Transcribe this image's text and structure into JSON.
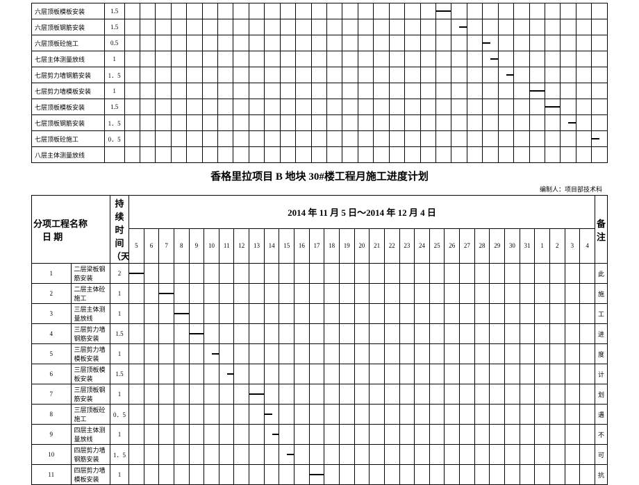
{
  "title": "香格里拉项目 B 地块 30#楼工程月施工进度计划",
  "author_label": "编制人：项目部技术科",
  "date_range": "2014 年 11 月 5 日～2014 年 12 月 4 日",
  "header_left": "分项工程名称\n　日 期",
  "header_dur": "持续时间（天）",
  "header_notes": "备注",
  "notes_chars": [
    "此",
    "施",
    "工",
    "进",
    "度",
    "计",
    "划",
    "遇",
    "不",
    "可",
    "抗"
  ],
  "bottom_days": [
    5,
    6,
    7,
    8,
    9,
    10,
    11,
    12,
    13,
    14,
    15,
    16,
    17,
    18,
    19,
    20,
    21,
    22,
    23,
    24,
    25,
    26,
    27,
    28,
    29,
    30,
    31,
    1,
    2,
    3,
    4
  ],
  "chart_data": [
    {
      "type": "table",
      "rows": [
        {
          "name": "六层顶板模板安装",
          "dur": "1.5",
          "start": 20,
          "len": 1.5
        },
        {
          "name": "六层顶板钢筋安装",
          "dur": "1.5",
          "start": 21.5,
          "len": 1.5
        },
        {
          "name": "六层顶板砼施工",
          "dur": "0.5",
          "start": 23,
          "len": 0.5
        },
        {
          "name": "七层主体测量放线",
          "dur": "1",
          "start": 23.5,
          "len": 1
        },
        {
          "name": "七层剪力墙钢筋安装",
          "dur": "1．5",
          "start": 24.5,
          "len": 1.5
        },
        {
          "name": "七层剪力墙模板安装",
          "dur": "1",
          "start": 26,
          "len": 1
        },
        {
          "name": "七层顶板模板安装",
          "dur": "1.5",
          "start": 27,
          "len": 1.5
        },
        {
          "name": "七层顶板钢筋安装",
          "dur": "1．5",
          "start": 28.5,
          "len": 1.5
        },
        {
          "name": "七层顶板砼施工",
          "dur": "0．5",
          "start": 30,
          "len": 0.5
        },
        {
          "name": "八层主体测量放线",
          "dur": "",
          "start": null,
          "len": null
        }
      ]
    },
    {
      "type": "table",
      "rows": [
        {
          "idx": 1,
          "name": "二层梁板钢筋安装",
          "dur": "2",
          "start": 0,
          "len": 2,
          "note": "此"
        },
        {
          "idx": 2,
          "name": "二层主体砼施工",
          "dur": "1",
          "start": 2,
          "len": 1,
          "note": "施"
        },
        {
          "idx": 3,
          "name": "三层主体测量放线",
          "dur": "1",
          "start": 3,
          "len": 1,
          "note": "工"
        },
        {
          "idx": 4,
          "name": "三层剪力墙钢筋安装",
          "dur": "1.5",
          "start": 4,
          "len": 1.5,
          "note": "进"
        },
        {
          "idx": 5,
          "name": "三层剪力墙模板安装",
          "dur": "1",
          "start": 5.5,
          "len": 1,
          "special": 1,
          "note": "度"
        },
        {
          "idx": 6,
          "name": "三层顶板模板安装",
          "dur": "1.5",
          "start": 6.5,
          "len": 1.5,
          "note": "计"
        },
        {
          "idx": 7,
          "name": "三层顶板钢筋安装",
          "dur": "1",
          "start": 8,
          "len": 1,
          "note": "划"
        },
        {
          "idx": 8,
          "name": "三层顶板砼施工",
          "dur": "0．5",
          "start": 9,
          "len": 0.5,
          "note": "遇"
        },
        {
          "idx": 9,
          "name": "四层主体测量放线",
          "dur": "1",
          "start": 9.5,
          "len": 1,
          "note": "不"
        },
        {
          "idx": 10,
          "name": "四层剪力墙钢筋安装",
          "dur": "1．5",
          "start": 10.5,
          "len": 1.5,
          "note": "可"
        },
        {
          "idx": 11,
          "name": "四层剪力墙模板安装",
          "dur": "1",
          "start": 12,
          "len": 1,
          "note": "抗"
        }
      ]
    }
  ]
}
